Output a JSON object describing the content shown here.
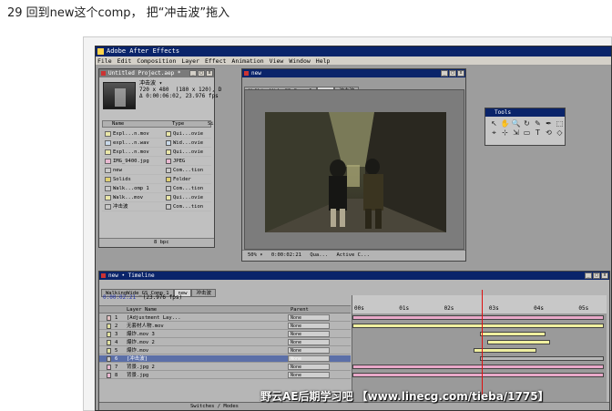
{
  "step_caption": "29 回到new这个comp， 把“冲击波”拖入",
  "app_title": "Adobe After Effects",
  "menu": [
    "File",
    "Edit",
    "Composition",
    "Layer",
    "Effect",
    "Animation",
    "View",
    "Window",
    "Help"
  ],
  "project": {
    "title": "Untitled Project.aep *",
    "selected_name": "冲击波 ▾",
    "info_line1": "720 x 480  (180 x 120), D",
    "info_line2": "Δ 0:00:06:02, 23.976 fps",
    "col_name": "Name",
    "col_type": "Type",
    "col_size": "Si",
    "items": [
      {
        "name": "Expl...n.mov",
        "type": "Qui...ovie",
        "color": "#e9e6a8"
      },
      {
        "name": "expl...n.wav",
        "type": "Wid...ovie",
        "color": "#c8d8e8"
      },
      {
        "name": "Expl...n.mov",
        "type": "Qui...ovie",
        "color": "#e9e6a8"
      },
      {
        "name": "IMG_9400.jpg",
        "type": "JPEG",
        "color": "#e8b8d0"
      },
      {
        "name": "new",
        "type": "Com...tion",
        "color": "#c8c8c8"
      },
      {
        "name": "Solids",
        "type": "Folder",
        "color": "#e0d070"
      },
      {
        "name": "Walk...omp 1",
        "type": "Com...tion",
        "color": "#c8c8c8"
      },
      {
        "name": "Walk...mov",
        "type": "Qui...ovie",
        "color": "#e9e6a8"
      },
      {
        "name": "冲击波",
        "type": "Com...tion",
        "color": "#c8c8c8"
      }
    ],
    "footer_bpc": "8 bpc"
  },
  "comp": {
    "title": "new",
    "tabs": [
      "WalkingWide_GS Comp 1",
      "new",
      "冲击波"
    ],
    "zoom": "50% ▾",
    "timecode": "0:00:02:21",
    "quality": "Qua...",
    "camera": "Active C..."
  },
  "tools": {
    "title": "Tools",
    "glyphs": [
      "↖",
      "✋",
      "🔍",
      "↻",
      "✎",
      "✒",
      "⬚",
      "⌖",
      "⊹",
      "⇲",
      "▭",
      "T",
      "⟲",
      "◇"
    ]
  },
  "timeline": {
    "title": "new • Timeline",
    "tabs": [
      "WalkingWide_GS Comp 1",
      "new",
      "冲击波"
    ],
    "timecode": "0:00:02:21",
    "fps": "(23.976 fps)",
    "col_layer": "Layer Name",
    "col_parent": "Parent",
    "ticks": [
      "00s",
      "01s",
      "02s",
      "03s",
      "04s",
      "05s"
    ],
    "layers": [
      {
        "num": "1",
        "name": "[Adjustment Lay...",
        "parent": "None",
        "label": "#e0c0c0"
      },
      {
        "num": "2",
        "name": "无套材人物.mov",
        "parent": "None",
        "label": "#e0e0a0"
      },
      {
        "num": "3",
        "name": "爆炸.mov 3",
        "parent": "None",
        "label": "#e0e0a0"
      },
      {
        "num": "4",
        "name": "爆炸.mov 2",
        "parent": "None",
        "label": "#e0e0a0"
      },
      {
        "num": "5",
        "name": "爆炸.mov",
        "parent": "None",
        "label": "#e0e0a0"
      },
      {
        "num": "6",
        "name": "[冲击波]",
        "parent": "None",
        "label": "#c8c8c8"
      },
      {
        "num": "7",
        "name": "背景.jpg 2",
        "parent": "None",
        "label": "#e8b8d0"
      },
      {
        "num": "8",
        "name": "背景.jpg",
        "parent": "None",
        "label": "#e8b8d0"
      }
    ],
    "bars": [
      {
        "start": 0.0,
        "end": 5.6,
        "color": "#e8a8c8"
      },
      {
        "start": 0.0,
        "end": 5.6,
        "color": "#f0f0a0"
      },
      {
        "start": 2.85,
        "end": 4.3,
        "color": "#f0f0a0"
      },
      {
        "start": 3.0,
        "end": 4.4,
        "color": "#f0f0a0"
      },
      {
        "start": 2.7,
        "end": 4.1,
        "color": "#f0f0a0"
      },
      {
        "start": 2.85,
        "end": 5.6,
        "color": "#b8b8b8"
      },
      {
        "start": 0.0,
        "end": 5.6,
        "color": "#e8a8c8"
      },
      {
        "start": 0.0,
        "end": 5.6,
        "color": "#e8a8c8"
      }
    ],
    "current_time_s": 2.9,
    "duration_s": 5.6,
    "footer": "Switches / Modes"
  },
  "watermark": "野云AE后期学习吧 【www.linecg.com/tieba/1775】"
}
